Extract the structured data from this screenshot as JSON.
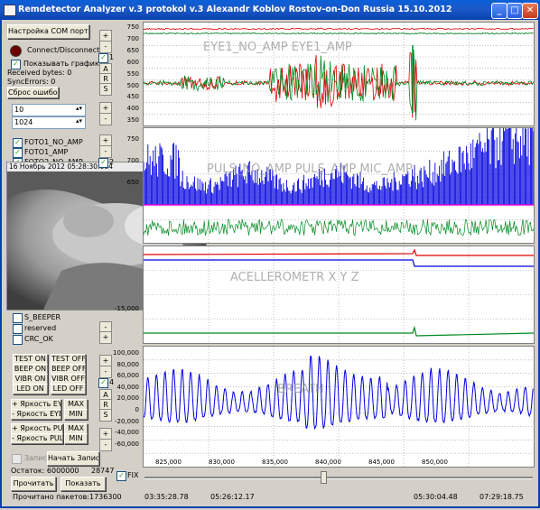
{
  "window": {
    "title": "Remdetector Analyzer v.3 protokol v.3 Alexandr Koblov Rostov-on-Don Russia 15.10.2012",
    "min": "_",
    "max": "□",
    "close": "✕"
  },
  "left": {
    "com_button": "Настройка COM порта",
    "connect_label": "Connect/Disconnect",
    "show_graphs": "Показывать графики",
    "received_bytes": "Received bytes: 0",
    "sync_errors": "SyncErrors: 0",
    "reset_errors": "Сброс ошибок",
    "input1": "10",
    "input2": "1024",
    "channels": [
      "FOTO1_NO_AMP",
      "FOTO1_AMP",
      "FOTO2_NO_AMP"
    ],
    "lower_channels": [
      "S_BEEPER",
      "reserved",
      "CRC_OK"
    ],
    "clipped_channel": "S_NOTE",
    "cmd_rows": [
      [
        "TEST ON",
        "TEST OFF"
      ],
      [
        "BEEP ON",
        "BEEP OFF"
      ],
      [
        "VIBR ON",
        "VIBR OFF"
      ],
      [
        "LED ON",
        "LED OFF"
      ]
    ],
    "bright_eye_plus": "+ Яркость EYE",
    "bright_eye_minus": "- Яркость EYE",
    "bright_puls_plus": "+ Яркость PULS",
    "bright_puls_minus": "- Яркость PULS",
    "max": "MAX",
    "min": "MIN",
    "record_cb": "Запис",
    "start_record": "Начать Запись",
    "remain": "Остаток: 6000000",
    "remain_val": "28747",
    "read_btn": "Прочитать",
    "show_btn": "Показать",
    "packets": "Прочитано пакетов:1736300"
  },
  "side_controls": {
    "plus": "+",
    "minus": "-",
    "n1": "1",
    "n2": "2",
    "n4": "4",
    "a": "A",
    "r": "R",
    "s": "S"
  },
  "video": {
    "timestamp": "16 Ноябрь 2012 05:28:30:664"
  },
  "charts": {
    "eye": {
      "overlay_text": "EYE1_NO_AMP EYE1_AMP",
      "y_ticks": [
        "750",
        "700",
        "650",
        "600",
        "550",
        "500",
        "450",
        "400",
        "350"
      ]
    },
    "puls": {
      "overlay_text": "PULS_NO_AMP  PULS_AMP  MIC_AMP",
      "y_ticks": [
        "750",
        "700",
        "650"
      ]
    },
    "accel": {
      "overlay_text": "ACELLEROMETR X Y Z",
      "y_ticks": [
        "-15,000"
      ]
    },
    "breath": {
      "overlay_text": "BREATH",
      "y_ticks": [
        "100,000",
        "80,000",
        "60,000",
        "40,000",
        "20,000",
        "0",
        "-20,000",
        "-40,000",
        "-60,000"
      ],
      "x_ticks": [
        "825,000",
        "830,000",
        "835,000",
        "840,000",
        "845,000",
        "850,000"
      ]
    }
  },
  "chart_data": {
    "type": "line",
    "title": "",
    "x_range": [
      822000,
      851000
    ],
    "panels": [
      {
        "name": "EYE",
        "ylim": [
          330,
          760
        ],
        "series": [
          {
            "color": "#e00000",
            "baseline": 505
          },
          {
            "color": "#008a20",
            "baseline": 505
          },
          {
            "color": "#e00000",
            "baseline": 740
          },
          {
            "color": "#008a20",
            "baseline": 725
          }
        ]
      },
      {
        "name": "PULS",
        "series": [
          {
            "color": "#0000e0"
          },
          {
            "color": "#008a20"
          },
          {
            "color": "#e000e0"
          }
        ]
      },
      {
        "name": "ACCEL",
        "series": [
          {
            "color": "#e00000"
          },
          {
            "color": "#0000e0"
          },
          {
            "color": "#008a20"
          }
        ]
      },
      {
        "name": "BREATH",
        "ylim": [
          -70000,
          105000
        ],
        "series": [
          {
            "color": "#0000e0"
          }
        ]
      }
    ]
  },
  "bottom": {
    "fix": "FIX",
    "times": [
      "03:35:28.78",
      "05:26:12.17",
      "05:30:04.48",
      "07:29:18.75"
    ]
  }
}
